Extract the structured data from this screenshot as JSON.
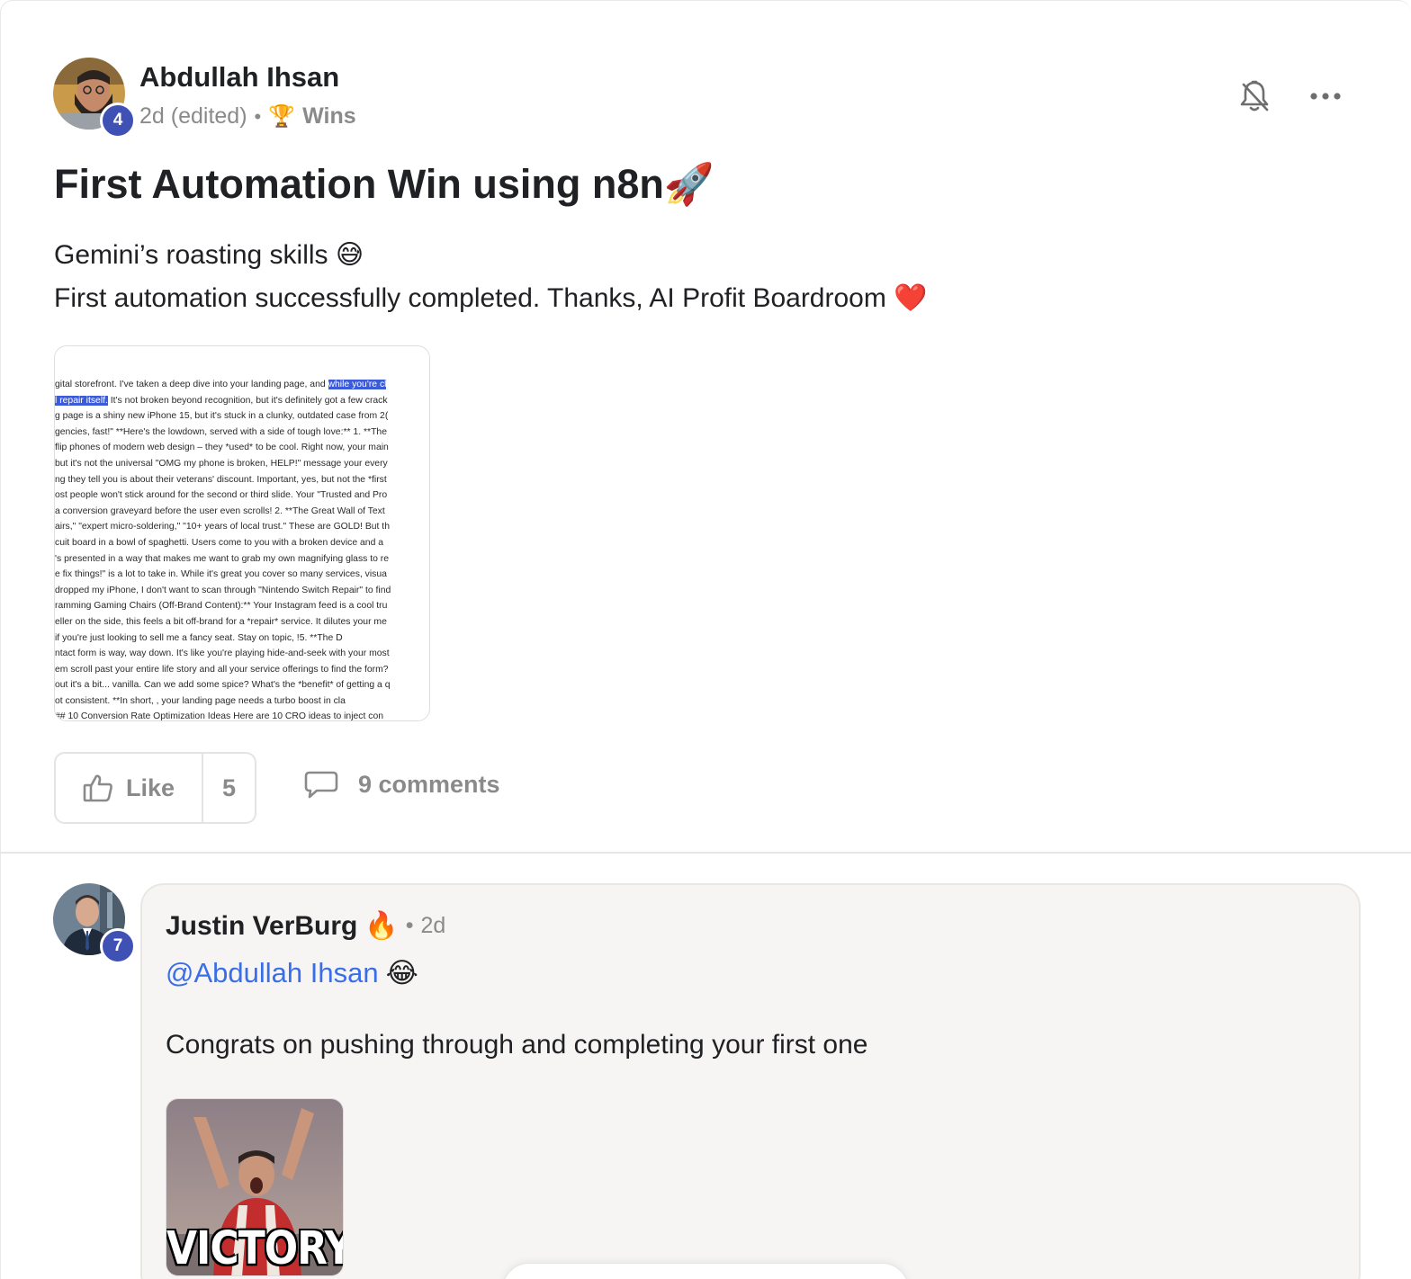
{
  "post": {
    "author": "Abdullah Ihsan",
    "author_level": "4",
    "time": "2d (edited)",
    "separator": "•",
    "category": "Wins",
    "title": "First Automation Win using n8n🚀",
    "body_line_1": "Gemini’s roasting skills 😅",
    "body_line_2": "First automation successfully completed. Thanks, AI Profit Boardroom ❤️",
    "attachment_lines": [
      "gital storefront. I've taken a deep dive into your landing page, and ",
      " It's not broken beyond recognition, but it's definitely got a few crack",
      "g page is a shiny new iPhone 15, but it's stuck in a clunky, outdated case from 2(",
      "gencies, fast!\" **Here's the lowdown, served with a side of tough love:** 1. **The",
      "flip phones of modern web design – they *used* to be cool. Right now, your main",
      "but it's not the universal \"OMG my phone is broken, HELP!\" message your every",
      "ng they tell you is about their veterans' discount. Important, yes, but not the *first",
      "ost people won't stick around for the second or third slide. Your \"Trusted and Pro",
      "a conversion graveyard before the user even scrolls! 2. **The Great Wall of Text",
      "airs,\" \"expert micro-soldering,\" \"10+ years of local trust.\" These are GOLD! But th",
      "cuit board in a bowl of spaghetti. Users come to you with a broken device and a",
      "'s presented in a way that makes me want to grab my own magnifying glass to re",
      "e fix things!\" is a lot to take in. While it's great you cover so many services, visua",
      "dropped my iPhone, I don't want to scan through \"Nintendo Switch Repair\" to find",
      "ramming Gaming Chairs (Off-Brand Content):** Your Instagram feed is a cool tru",
      "eller on the side, this feels a bit off-brand for a *repair* service. It dilutes your me",
      "if you're just looking to sell me a fancy seat. Stay on topic,              !5. **The D",
      "ntact form is way, way down. It's like you're playing hide-and-seek with your most",
      "em scroll past your entire life story and all your service offerings to find the form?",
      "out it's a bit... vanilla. Can we add some spice? What's the *benefit* of getting a q",
      "ot consistent. **In short,              , your landing page needs a turbo boost in cla",
      "## 10 Conversion Rate Optimization Ideas Here are 10 CRO ideas to inject con"
    ],
    "attachment_highlight_1": "while you're cl",
    "attachment_highlight_2": "l repair itself.",
    "like_label": "Like",
    "like_count": "5",
    "comments_label": "9 comments"
  },
  "comment": {
    "author": "Justin VerBurg",
    "author_badge": "🔥",
    "author_level": "7",
    "separator": "•",
    "time": "2d",
    "mention": "@Abdullah Ihsan",
    "mention_emoji": "😂",
    "text": "Congrats on pushing through and completing your first one",
    "gif_caption": "VICTORY"
  },
  "icons": {
    "notify": "bell-off-icon",
    "more": "more-horizontal-icon",
    "like": "thumbs-up-icon",
    "comments": "comment-bubble-icon",
    "category": "trophy-icon"
  },
  "colors": {
    "level_badge": "#3f51b5",
    "mention": "#3a6ee8",
    "highlight": "#3b5bdb",
    "muted": "#8a8a8a"
  }
}
